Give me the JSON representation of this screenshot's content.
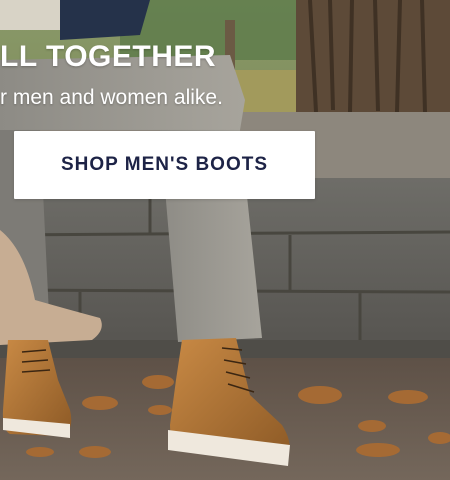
{
  "hero": {
    "headline": "LL TOGETHER",
    "subline": "r men and women alike.",
    "cta_label": "SHOP MEN'S BOOTS"
  },
  "colors": {
    "cta_background": "#ffffff",
    "cta_text": "#1d2346",
    "headline_text": "#ffffff"
  }
}
